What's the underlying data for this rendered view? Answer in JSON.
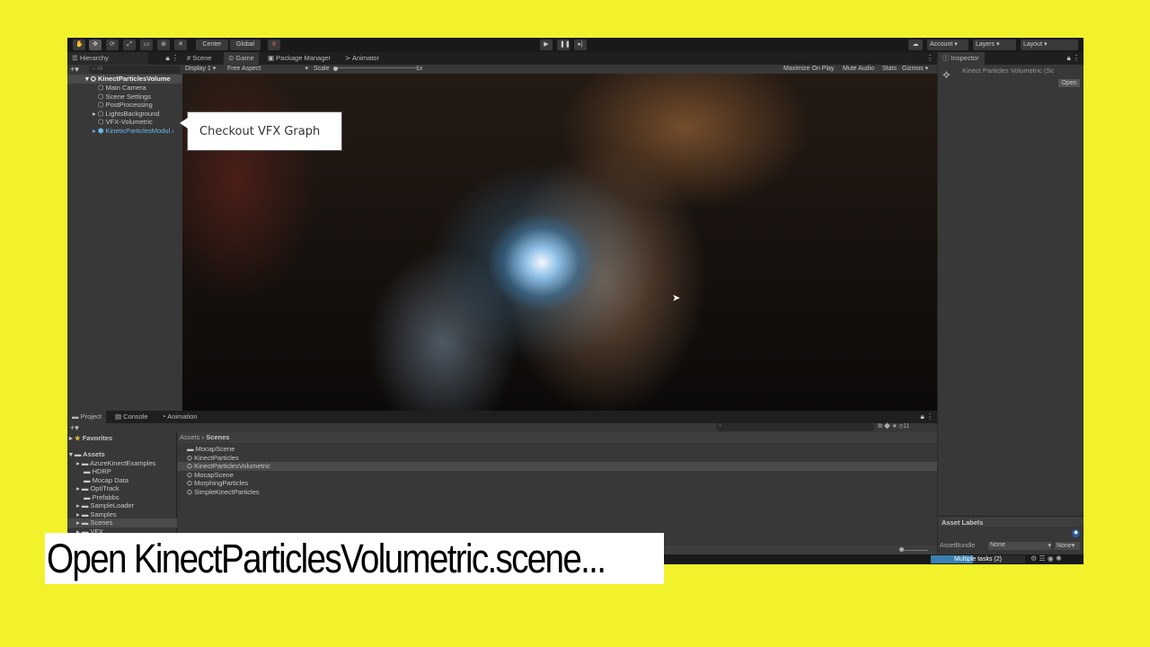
{
  "toolbar": {
    "tools": [
      "hand",
      "move",
      "rotate",
      "scale",
      "rect",
      "transform",
      "custom"
    ],
    "pivot": "Center",
    "space": "Global",
    "account": "Account",
    "layers": "Layers",
    "layout": "Layout"
  },
  "hierarchy": {
    "tab": "Hierarchy",
    "search_placeholder": "All",
    "root": "KinectParticlesVolume",
    "items": [
      "Main Camera",
      "Scene Settings",
      "PostProcessing",
      "LightsBackground",
      "VFX-Volumetric",
      "KineticParticlesModul"
    ]
  },
  "center_tabs": [
    "Scene",
    "Game",
    "Package Manager",
    "Animator"
  ],
  "game_bar": {
    "display": "Display 1",
    "aspect": "Free Aspect",
    "scale_label": "Scale",
    "scale_value": "1x",
    "maximize": "Maximize On Play",
    "mute": "Mute Audio",
    "stats": "Stats",
    "gizmos": "Gizmos"
  },
  "inspector": {
    "tab": "Inspector",
    "title": "Kinect Particles Volumetric (Sc",
    "open": "Open",
    "asset_labels": "Asset Labels",
    "asset_bundle": "AssetBundle",
    "bundle_value": "None",
    "variant_value": "None"
  },
  "callout": "Checkout VFX Graph",
  "project": {
    "tabs": [
      "Project",
      "Console",
      "Animation"
    ],
    "favorites": "Favorites",
    "assets": "Assets",
    "folders": [
      "AzureKinectExamples",
      "HDRP",
      "Mocap Data",
      "OptiTrack",
      "Prefabbs",
      "SampleLoader",
      "Samples",
      "Scenes",
      "VFX"
    ],
    "breadcrumb": [
      "Assets",
      "Scenes"
    ],
    "files": [
      "MocapScene",
      "KinectParticles",
      "KinectParticlesVolumetric",
      "MocapScene",
      "MorphingParticles",
      "SimpleKinectParticles"
    ],
    "hidden_count": "11"
  },
  "status": {
    "tasks": "Multiple tasks (2)"
  },
  "caption": "Open KinectParticlesVolumetric.scene..."
}
